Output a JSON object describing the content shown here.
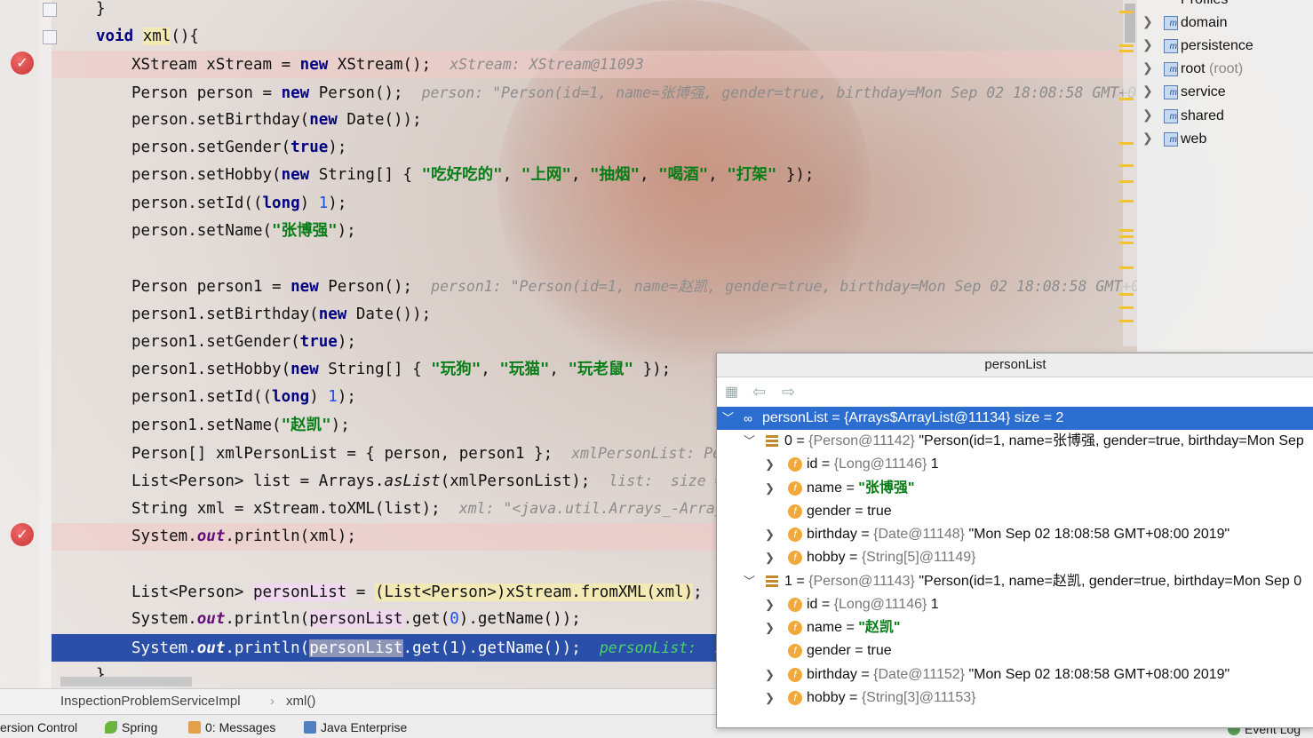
{
  "editor": {
    "lines": [
      {
        "text": "}"
      },
      {
        "text": "void xml(){"
      },
      {
        "text": "XStream xStream = new XStream();",
        "hint": "xStream: XStream@11093"
      },
      {
        "text": "Person person = new Person();",
        "hint": "person: \"Person(id=1, name=张博强, gender=true, birthday=Mon Sep 02 18:08:58 GMT+0"
      },
      {
        "text": "person.setBirthday(new Date());"
      },
      {
        "text": "person.setGender(true);"
      },
      {
        "text": "person.setHobby(new String[] { \"吃好吃的\", \"上网\", \"抽烟\", \"喝酒\", \"打架\" });"
      },
      {
        "text": "person.setId((long) 1);"
      },
      {
        "text": "person.setName(\"张博强\");"
      },
      {
        "text": ""
      },
      {
        "text": "Person person1 = new Person();",
        "hint": "person1: \"Person(id=1, name=赵凯, gender=true, birthday=Mon Sep 02 18:08:58 GMT+0"
      },
      {
        "text": "person1.setBirthday(new Date());"
      },
      {
        "text": "person1.setGender(true);"
      },
      {
        "text": "person1.setHobby(new String[] { \"玩狗\", \"玩猫\", \"玩老鼠\" });"
      },
      {
        "text": "person1.setId((long) 1);"
      },
      {
        "text": "person1.setName(\"赵凯\");"
      },
      {
        "text": "Person[] xmlPersonList = { person, person1 };",
        "hint": "xmlPersonList: Pers"
      },
      {
        "text": "List<Person> list = Arrays.asList(xmlPersonList);",
        "hint": "list:  size = 2"
      },
      {
        "text": "String xml = xStream.toXML(list);",
        "hint": "xml: \"<java.util.Arrays_-ArrayL"
      },
      {
        "text": "System.out.println(xml);"
      },
      {
        "text": ""
      },
      {
        "text": "List<Person> personList = (List<Person>)xStream.fromXML(xml);",
        "hint": "per"
      },
      {
        "text": "System.out.println(personList.get(0).getName());"
      },
      {
        "text": "System.out.println(personList.get(1).getName());",
        "hint": "personList:  si"
      },
      {
        "text": "}"
      }
    ]
  },
  "tree": {
    "items": [
      {
        "label": "Profiles"
      },
      {
        "label": "domain"
      },
      {
        "label": "persistence"
      },
      {
        "label": "root",
        "sub": "(root)"
      },
      {
        "label": "service"
      },
      {
        "label": "shared"
      },
      {
        "label": "web"
      }
    ]
  },
  "breadcrumb": {
    "class": "InspectionProblemServiceImpl",
    "method": "xml()"
  },
  "status": {
    "version_control": "ersion Control",
    "spring": "Spring",
    "messages": "0: Messages",
    "java_enterprise": "Java Enterprise",
    "event_log": "Event Log"
  },
  "popup": {
    "title": "personList",
    "rows": [
      {
        "name": "personList",
        "eq": " = ",
        "type": "{Arrays$ArrayList@11134}",
        "value": " size = 2"
      },
      {
        "name": "0",
        "eq": " = ",
        "type": "{Person@11142}",
        "value": " \"Person(id=1, name=张博强, gender=true, birthday=Mon Sep"
      },
      {
        "name": "id",
        "eq": " = ",
        "type": "{Long@11146}",
        "value": " 1"
      },
      {
        "name": "name",
        "eq": " = ",
        "str": "\"张博强\""
      },
      {
        "name": "gender",
        "eq": " = ",
        "value": "true"
      },
      {
        "name": "birthday",
        "eq": " = ",
        "type": "{Date@11148}",
        "value": " \"Mon Sep 02 18:08:58 GMT+08:00 2019\""
      },
      {
        "name": "hobby",
        "eq": " = ",
        "type": "{String[5]@11149}"
      },
      {
        "name": "1",
        "eq": " = ",
        "type": "{Person@11143}",
        "value": " \"Person(id=1, name=赵凯, gender=true, birthday=Mon Sep 0"
      },
      {
        "name": "id",
        "eq": " = ",
        "type": "{Long@11146}",
        "value": " 1"
      },
      {
        "name": "name",
        "eq": " = ",
        "str": "\"赵凯\""
      },
      {
        "name": "gender",
        "eq": " = ",
        "value": "true"
      },
      {
        "name": "birthday",
        "eq": " = ",
        "type": "{Date@11152}",
        "value": " \"Mon Sep 02 18:08:58 GMT+08:00 2019\""
      },
      {
        "name": "hobby",
        "eq": " = ",
        "type": "{String[3]@11153}"
      }
    ]
  }
}
